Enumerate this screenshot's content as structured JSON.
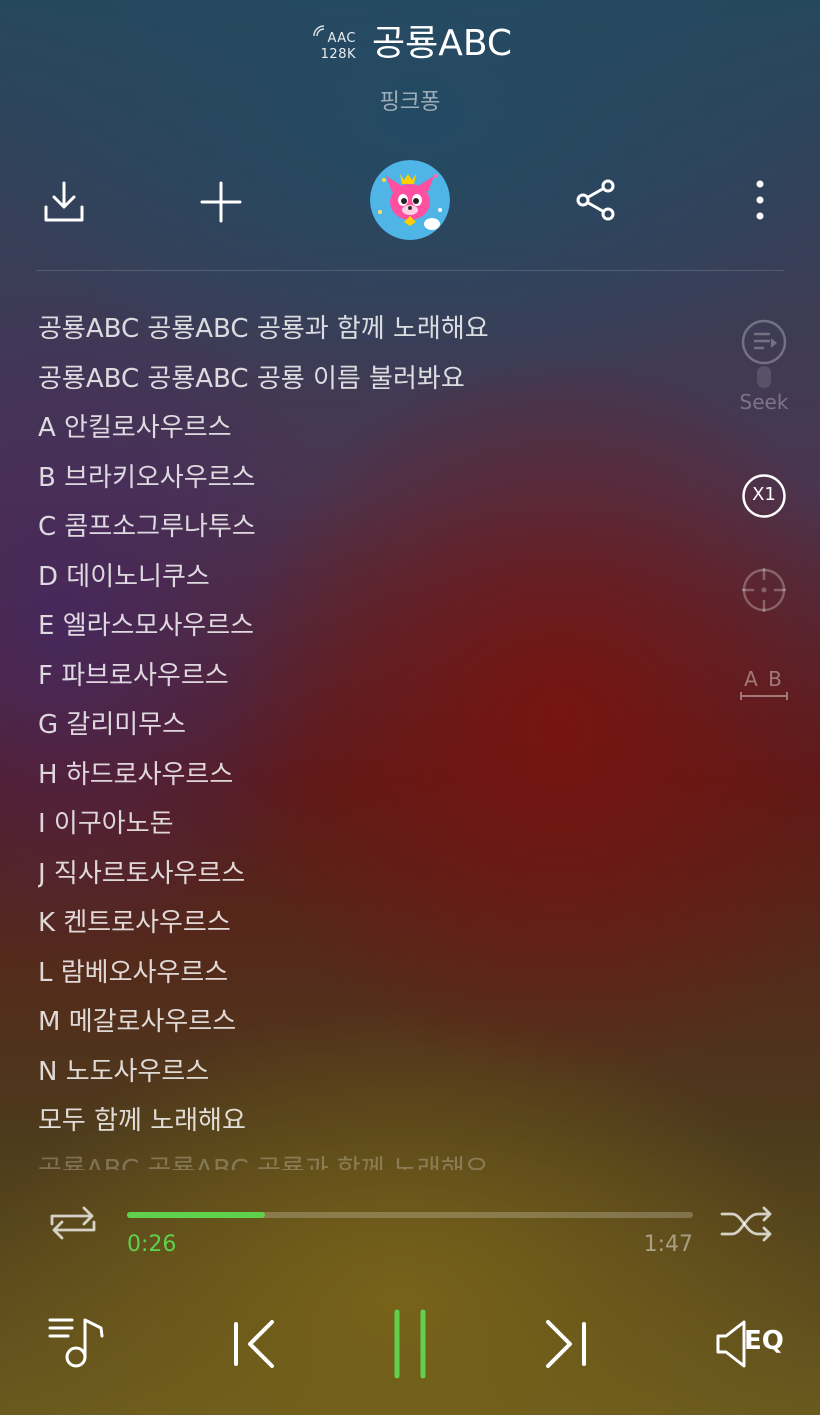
{
  "header": {
    "codec_line1": "AAC",
    "codec_line2": "128K",
    "title": "공룡ABC",
    "artist": "핑크퐁"
  },
  "toolbar": {
    "download_icon": "download-icon",
    "add_icon": "plus-icon",
    "album_art": "album-art-avatar",
    "share_icon": "share-icon",
    "more_icon": "more-vertical-icon"
  },
  "lyrics": [
    "공룡ABC 공룡ABC 공룡과 함께 노래해요",
    "공룡ABC 공룡ABC 공룡 이름 불러봐요",
    "A 안킬로사우르스",
    "B 브라키오사우르스",
    "C 콤프소그루나투스",
    "D 데이노니쿠스",
    "E 엘라스모사우르스",
    "F 파브로사우르스",
    "G 갈리미무스",
    "H 하드로사우르스",
    "I 이구아노돈",
    "J 직사르토사우르스",
    "K 켄트로사우르스",
    "L 람베오사우르스",
    "M 메갈로사우르스",
    "N 노도사우르스",
    "모두 함께 노래해요",
    "공룡ABC 공룡ABC 공룡과 함께 노래해요"
  ],
  "side_tools": {
    "seek_label": "Seek",
    "speed_label": "X1",
    "ab_label": "A B"
  },
  "progress": {
    "current": "0:26",
    "total": "1:47",
    "fraction": 0.243
  },
  "controls": {
    "repeat_icon": "repeat-icon",
    "shuffle_icon": "shuffle-icon",
    "playlist_icon": "playlist-icon",
    "prev_icon": "previous-icon",
    "pause_icon": "pause-icon",
    "next_icon": "next-icon",
    "eq_label": "EQ"
  },
  "colors": {
    "accent": "#5fd14c"
  }
}
